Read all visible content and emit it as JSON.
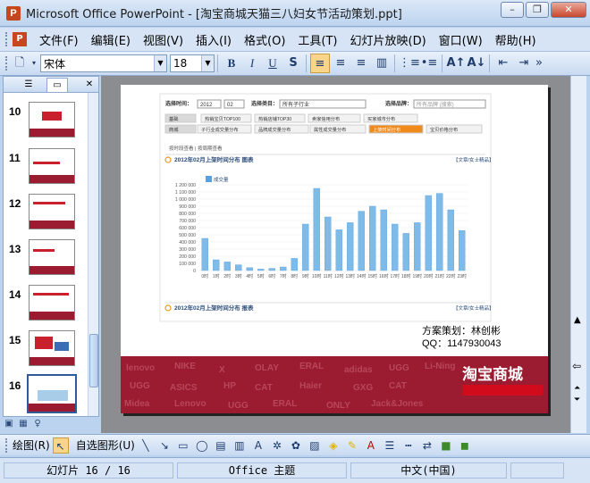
{
  "window": {
    "title": "Microsoft Office PowerPoint - [淘宝商城天猫三八妇女节活动策划.ppt]"
  },
  "menu": [
    "文件(F)",
    "编辑(E)",
    "视图(V)",
    "插入(I)",
    "格式(O)",
    "工具(T)",
    "幻灯片放映(D)",
    "窗口(W)",
    "帮助(H)"
  ],
  "toolbar": {
    "font": "宋体",
    "size": "18"
  },
  "thumbnails": [
    {
      "num": "10"
    },
    {
      "num": "11"
    },
    {
      "num": "12"
    },
    {
      "num": "13"
    },
    {
      "num": "14"
    },
    {
      "num": "15"
    },
    {
      "num": "16"
    }
  ],
  "slide": {
    "filter_time_label": "选择时间：",
    "filter_year": "2012",
    "filter_month": "02",
    "filter_category_label": "选择类目：",
    "filter_category": "所有子行业",
    "filter_brand_label": "选择品牌：",
    "filter_brand_placeholder": "所有品牌 (搜索)",
    "tabs_row1": [
      "基础",
      "热销宝贝TOP100",
      "热销店铺TOP30",
      "卖家信用分布",
      "买家城市分布"
    ],
    "tabs_row2": [
      "商城",
      "子行业成交量分布",
      "品牌成交量分布",
      "属性成交量分布",
      "上架时间分布",
      "宝贝价格分布"
    ],
    "breadcrumb": "按时段查看 | 按周期查看",
    "section1_title": "2012年02月上架时间分布  图表",
    "section1_link": "【文章/女士精品】",
    "section2_title": "2012年02月上架时间分布  报表",
    "section2_link": "【文章/女士精品】",
    "legend": "成交量",
    "footer_planner": "方案策划：林创彬",
    "footer_qq": "QQ：1147930043",
    "brand_logo": "淘宝商城"
  },
  "chart_data": {
    "type": "bar",
    "categories": [
      "0时",
      "1时",
      "2时",
      "3时",
      "4时",
      "5时",
      "6时",
      "7时",
      "8时",
      "9时",
      "10时",
      "11时",
      "12时",
      "13时",
      "14时",
      "15时",
      "16时",
      "17时",
      "18时",
      "19时",
      "20时",
      "21时",
      "22时",
      "23时"
    ],
    "series": [
      {
        "name": "成交量",
        "values": [
          450000,
          150000,
          120000,
          80000,
          40000,
          20000,
          30000,
          50000,
          170000,
          650000,
          1150000,
          750000,
          570000,
          670000,
          830000,
          900000,
          850000,
          650000,
          520000,
          670000,
          1050000,
          1080000,
          850000,
          560000
        ]
      }
    ],
    "ylim": [
      0,
      1200000
    ],
    "yticks": [
      "1 200 000",
      "1 100 000",
      "1 000 000",
      "900 000",
      "800 000",
      "700 000",
      "600 000",
      "500 000",
      "400 000",
      "300 000",
      "200 000",
      "100 000",
      "0"
    ],
    "grid": true,
    "legend_position": "top-left"
  },
  "status": {
    "slide": "幻灯片 16 / 16",
    "theme": "Office 主题",
    "lang": "中文(中国)"
  },
  "draw": {
    "label": "绘图(R)",
    "autoshape": "自选图形(U)"
  }
}
